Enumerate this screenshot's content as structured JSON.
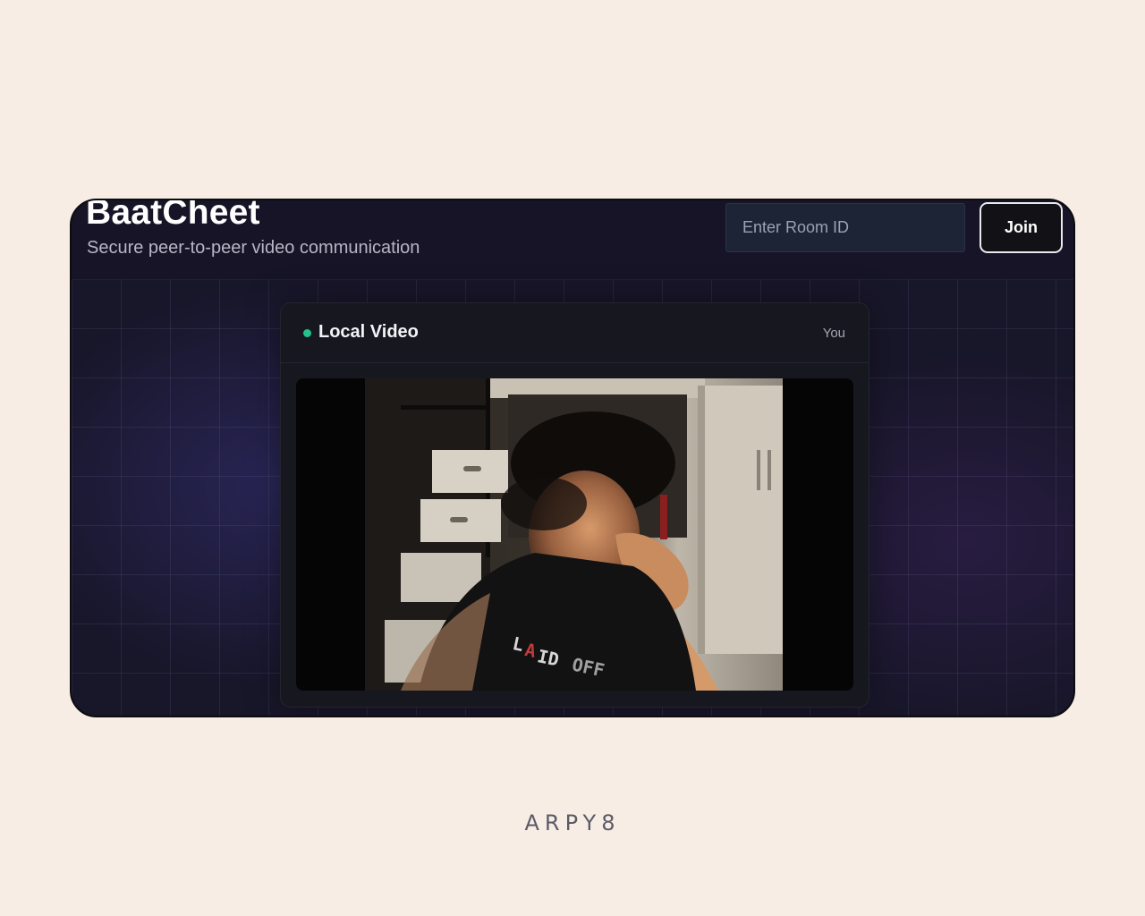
{
  "header": {
    "title": "BaatCheet",
    "subtitle": "Secure peer-to-peer video communication"
  },
  "room": {
    "placeholder": "Enter Room ID",
    "value": "",
    "join_label": "Join"
  },
  "video_card": {
    "title": "Local Video",
    "badge": "You",
    "status_color": "#22c28a"
  },
  "watermark": "ARPY8",
  "colors": {
    "page_background": "#f7ede5",
    "app_background": "#181629",
    "card_background": "#17171f",
    "accent_green": "#22c28a"
  }
}
